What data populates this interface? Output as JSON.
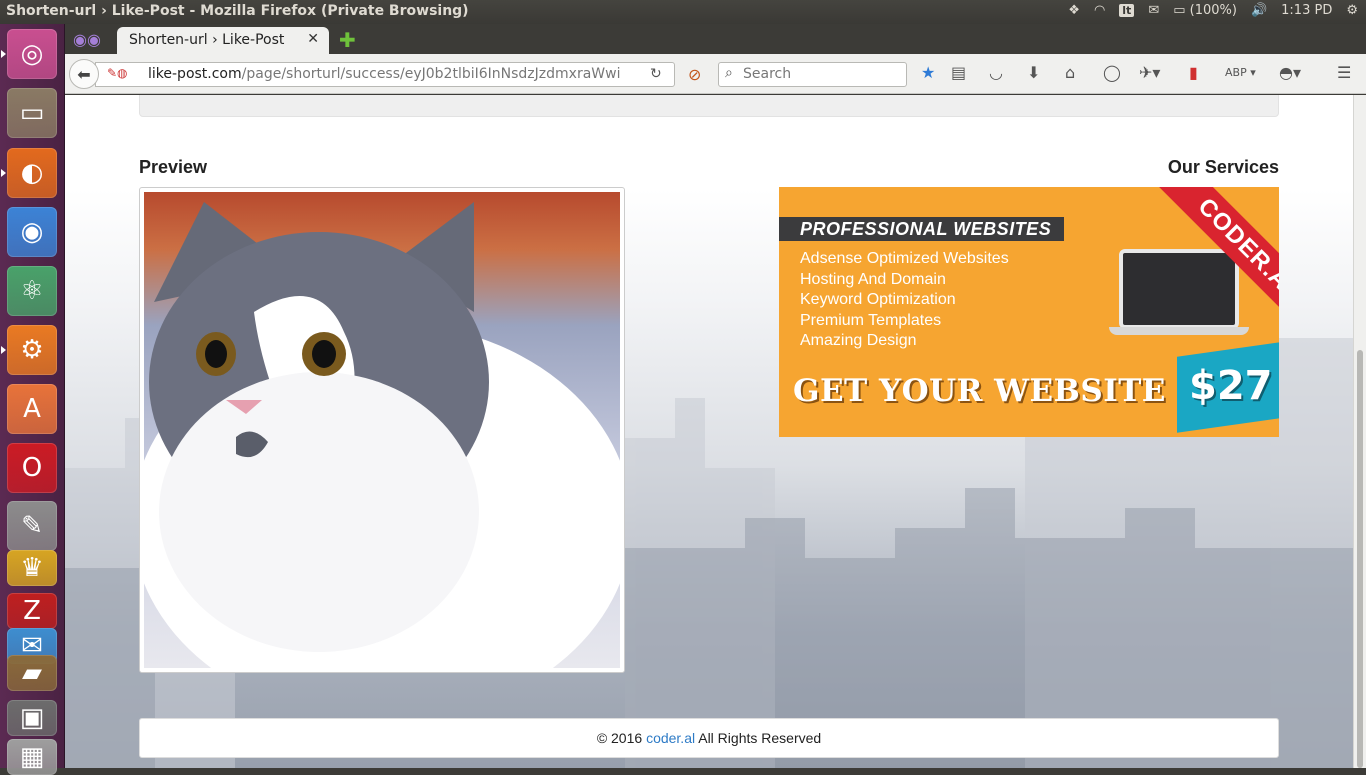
{
  "window": {
    "title": "Shorten-url › Like-Post - Mozilla Firefox (Private Browsing)",
    "tray": {
      "keyboard_layout": "lt",
      "battery": "(100%)",
      "clock": "1:13 PD"
    }
  },
  "launcher": {
    "items": [
      {
        "name": "ubuntu-dash",
        "color": "#c94f90"
      },
      {
        "name": "files",
        "color": "#8a7a64"
      },
      {
        "name": "firefox",
        "color": "#e36a1d"
      },
      {
        "name": "chrome",
        "color": "#3c83d6"
      },
      {
        "name": "atom",
        "color": "#49a26a"
      },
      {
        "name": "system-settings",
        "color": "#ea7a22"
      },
      {
        "name": "software-center",
        "color": "#e8733a"
      },
      {
        "name": "opera",
        "color": "#cc1b24"
      },
      {
        "name": "tools",
        "color": "#8c8c8c"
      },
      {
        "name": "trophy-app",
        "color": "#d7a522"
      },
      {
        "name": "filezilla",
        "color": "#bf1f1f"
      },
      {
        "name": "mail-app",
        "color": "#3d8ed0"
      },
      {
        "name": "folder-app",
        "color": "#8a6a3a"
      },
      {
        "name": "terminal",
        "color": "#6c6c6c"
      },
      {
        "name": "scanner",
        "color": "#9e9e9e"
      }
    ]
  },
  "browser": {
    "tab_label": "Shorten-url › Like-Post",
    "url_host": "like-post.com",
    "url_path": "/page/shorturl/success/eyJ0b2tlbiI6InNsdzJzdmxraWwi",
    "search_placeholder": "Search"
  },
  "page": {
    "preview_title": "Preview",
    "services_title": "Our Services",
    "ad": {
      "heading": "PROFESSIONAL WEBSITES",
      "features": [
        "Adsense Optimized Websites",
        "Hosting And Domain",
        "Keyword Optimization",
        "Premium Templates",
        "Amazing Design"
      ],
      "cta": "GET YOUR WEBSITE FOR",
      "price": "$27",
      "ribbon": "CODER.AL"
    },
    "footer": {
      "prefix": "© 2016",
      "link": "coder.al",
      "suffix": "All Rights Reserved"
    }
  }
}
